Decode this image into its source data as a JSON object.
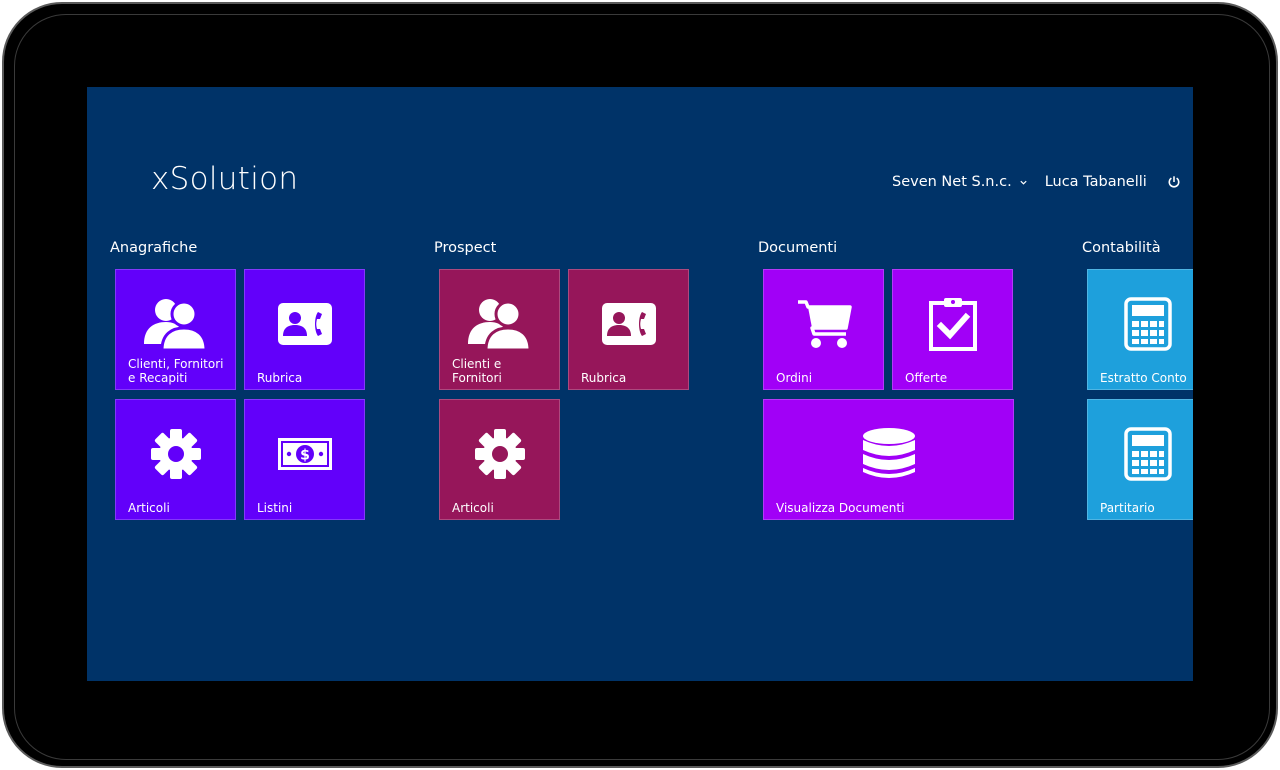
{
  "app": {
    "title": "xSolution",
    "company": "Seven Net S.n.c.",
    "user": "Luca Tabanelli"
  },
  "colors": {
    "background": "#003368",
    "anagrafiche": "#6200fa",
    "prospect": "#96165a",
    "documenti": "#a100f7",
    "contabilita": "#1ea0dc"
  },
  "groups": [
    {
      "title": "Anagrafiche",
      "tiles": [
        {
          "label": "Clienti, Fornitori e Recapiti",
          "icon": "users-icon"
        },
        {
          "label": "Rubrica",
          "icon": "contact-card-icon"
        },
        {
          "label": "Articoli",
          "icon": "gear-icon"
        },
        {
          "label": "Listini",
          "icon": "money-icon"
        }
      ]
    },
    {
      "title": "Prospect",
      "tiles": [
        {
          "label": "Clienti e Fornitori",
          "icon": "users-icon"
        },
        {
          "label": "Rubrica",
          "icon": "contact-card-icon"
        },
        {
          "label": "Articoli",
          "icon": "gear-icon"
        }
      ]
    },
    {
      "title": "Documenti",
      "tiles": [
        {
          "label": "Ordini",
          "icon": "cart-icon"
        },
        {
          "label": "Offerte",
          "icon": "clipboard-check-icon"
        },
        {
          "label": "Visualizza Documenti",
          "icon": "database-icon"
        }
      ]
    },
    {
      "title": "Contabilità",
      "tiles": [
        {
          "label": "Estratto Conto",
          "icon": "calculator-icon"
        },
        {
          "label": "Partitario",
          "icon": "calculator-icon"
        }
      ]
    }
  ]
}
